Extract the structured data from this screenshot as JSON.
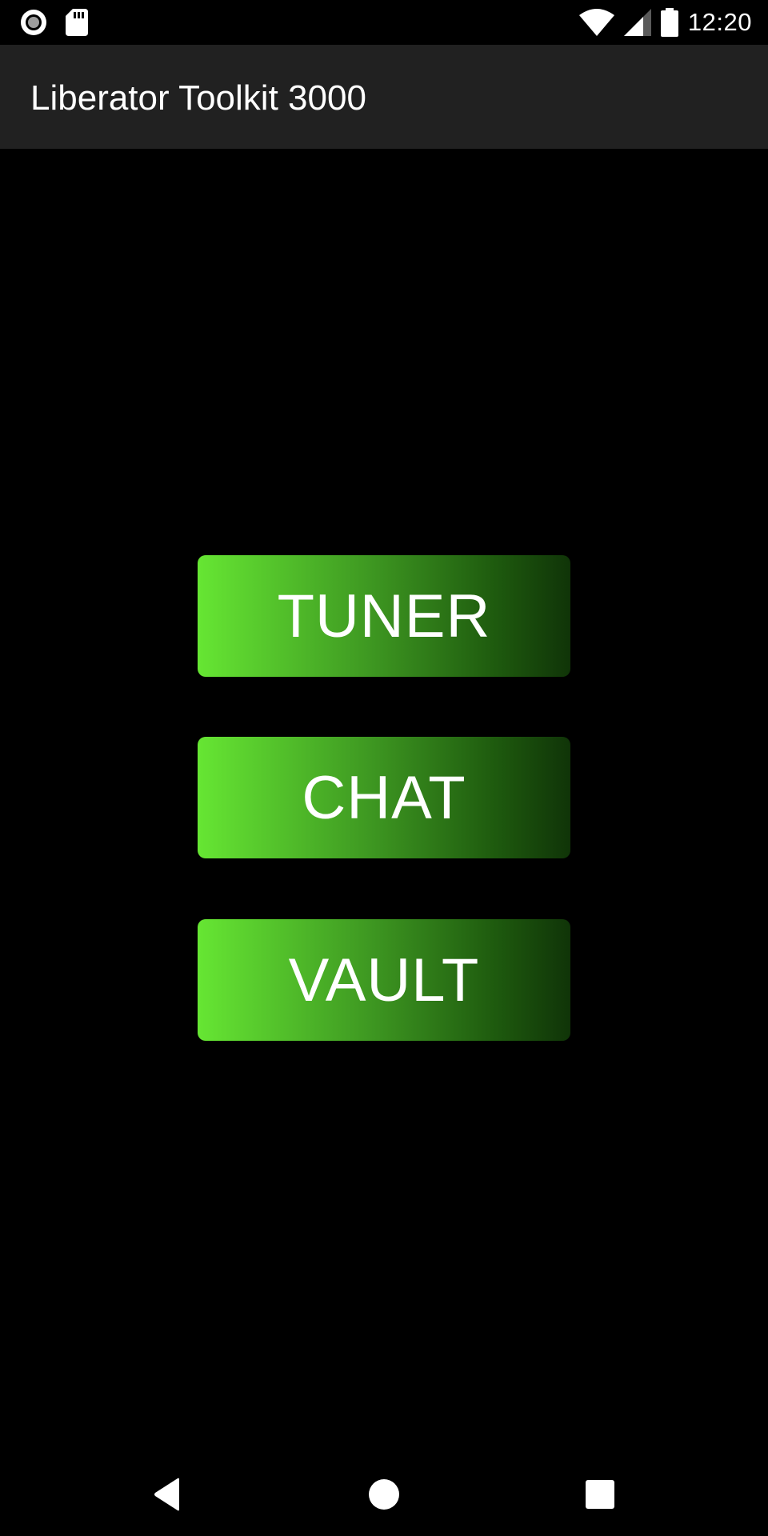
{
  "status_bar": {
    "time": "12:20",
    "left_icons": [
      "record-icon",
      "sd-card-icon"
    ],
    "right_icons": [
      "wifi-icon",
      "cell-signal-icon",
      "battery-icon"
    ]
  },
  "app_bar": {
    "title": "Liberator Toolkit 3000"
  },
  "buttons": [
    {
      "label": "TUNER"
    },
    {
      "label": "CHAT"
    },
    {
      "label": "VAULT"
    }
  ],
  "nav_bar": {
    "icons": [
      "back-icon",
      "home-icon",
      "recents-icon"
    ]
  },
  "colors": {
    "background": "#000000",
    "app_bar": "#212121",
    "button_gradient_start": "#66e633",
    "button_gradient_end": "#103408",
    "text": "#ffffff"
  }
}
